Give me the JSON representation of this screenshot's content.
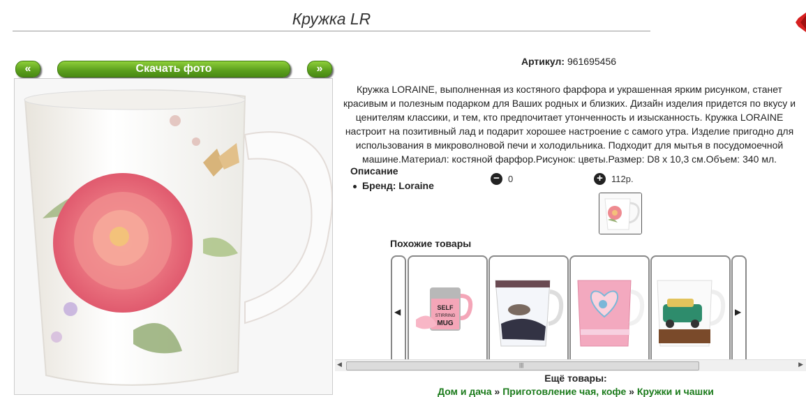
{
  "page": {
    "title": "Кружка LR"
  },
  "gallery": {
    "prev_label": "«",
    "download_label": "Скачать фото",
    "next_label": "»"
  },
  "product": {
    "artikul_label": "Артикул:",
    "artikul_value": "961695456",
    "description": "Кружка LORAINE, выполненная из костяного фарфора и украшенная ярким рисунком, станет красивым и полезным подарком для Ваших родных и близких. Дизайн изделия придется по вкусу и ценителям классики, и тем, кто предпочитает утонченность и изысканность. Кружка LORAINE настроит на позитивный лад и подарит хорошее настроение с самого утра. Изделие пригодно для использования в микроволновой печи и холодильника. Подходит для мытья в посудомоечной машине.Материал: костяной фарфор.Рисунок: цветы.Размер: D8 x 10,3 см.Объем: 340 мл.",
    "section_label": "Описание",
    "brand_item": "Бренд: Loraine",
    "vote_minus_value": "0",
    "vote_plus_value": "112р."
  },
  "similar": {
    "heading": "Похожие товары",
    "items": [
      {
        "alt": "Self stirring mug"
      },
      {
        "alt": "Fashion mug"
      },
      {
        "alt": "Pink heart mug"
      },
      {
        "alt": "Retro car mug"
      }
    ]
  },
  "more": {
    "heading": "Ещё товары:",
    "crumbs": [
      "Дом и дача",
      "Приготовление чая, кофе",
      "Кружки и чашки"
    ],
    "separator": "»"
  },
  "colors": {
    "accent_green": "#5a9e1c",
    "link_green": "#1a7a1a",
    "close_red": "#d62020"
  },
  "icons": {
    "prev": "chevron-left-icon",
    "next": "chevron-right-icon",
    "minus": "minus-circle-icon",
    "plus": "plus-circle-icon",
    "close": "close-icon"
  }
}
